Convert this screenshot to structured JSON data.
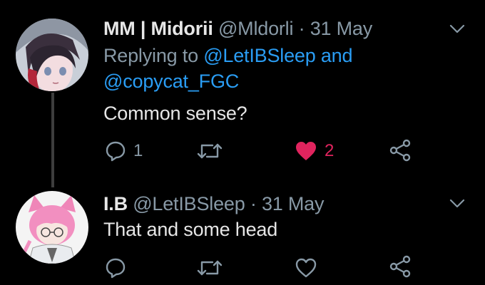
{
  "colors": {
    "background": "#000000",
    "link": "#2a9df4",
    "meta": "#8899a6",
    "text": "#e6e6e6",
    "like_active": "#e0245e",
    "thread_line": "#3d3d3d"
  },
  "tweets": [
    {
      "display_name": "MM | Midorii",
      "handle": "@Mldorli",
      "separator": "·",
      "date": "31 May",
      "replying_prefix": "Replying to",
      "replying_to_1": "@LetIBSleep",
      "replying_and": "and",
      "replying_to_2": "@copycat_FGC",
      "text": "Common sense?",
      "actions": {
        "reply": {
          "icon": "reply-icon",
          "count": "1"
        },
        "retweet": {
          "icon": "retweet-icon",
          "count": ""
        },
        "like": {
          "icon": "heart-filled-icon",
          "count": "2",
          "liked": true
        },
        "share": {
          "icon": "share-icon"
        }
      },
      "menu_icon": "chevron-down-icon"
    },
    {
      "display_name": "I.B",
      "handle": "@LetIBSleep",
      "separator": "·",
      "date": "31 May",
      "text": "That and some head",
      "actions": {
        "reply": {
          "icon": "reply-icon",
          "count": ""
        },
        "retweet": {
          "icon": "retweet-icon",
          "count": ""
        },
        "like": {
          "icon": "heart-outline-icon",
          "count": "",
          "liked": false
        },
        "share": {
          "icon": "share-icon"
        }
      },
      "menu_icon": "chevron-down-icon"
    }
  ]
}
